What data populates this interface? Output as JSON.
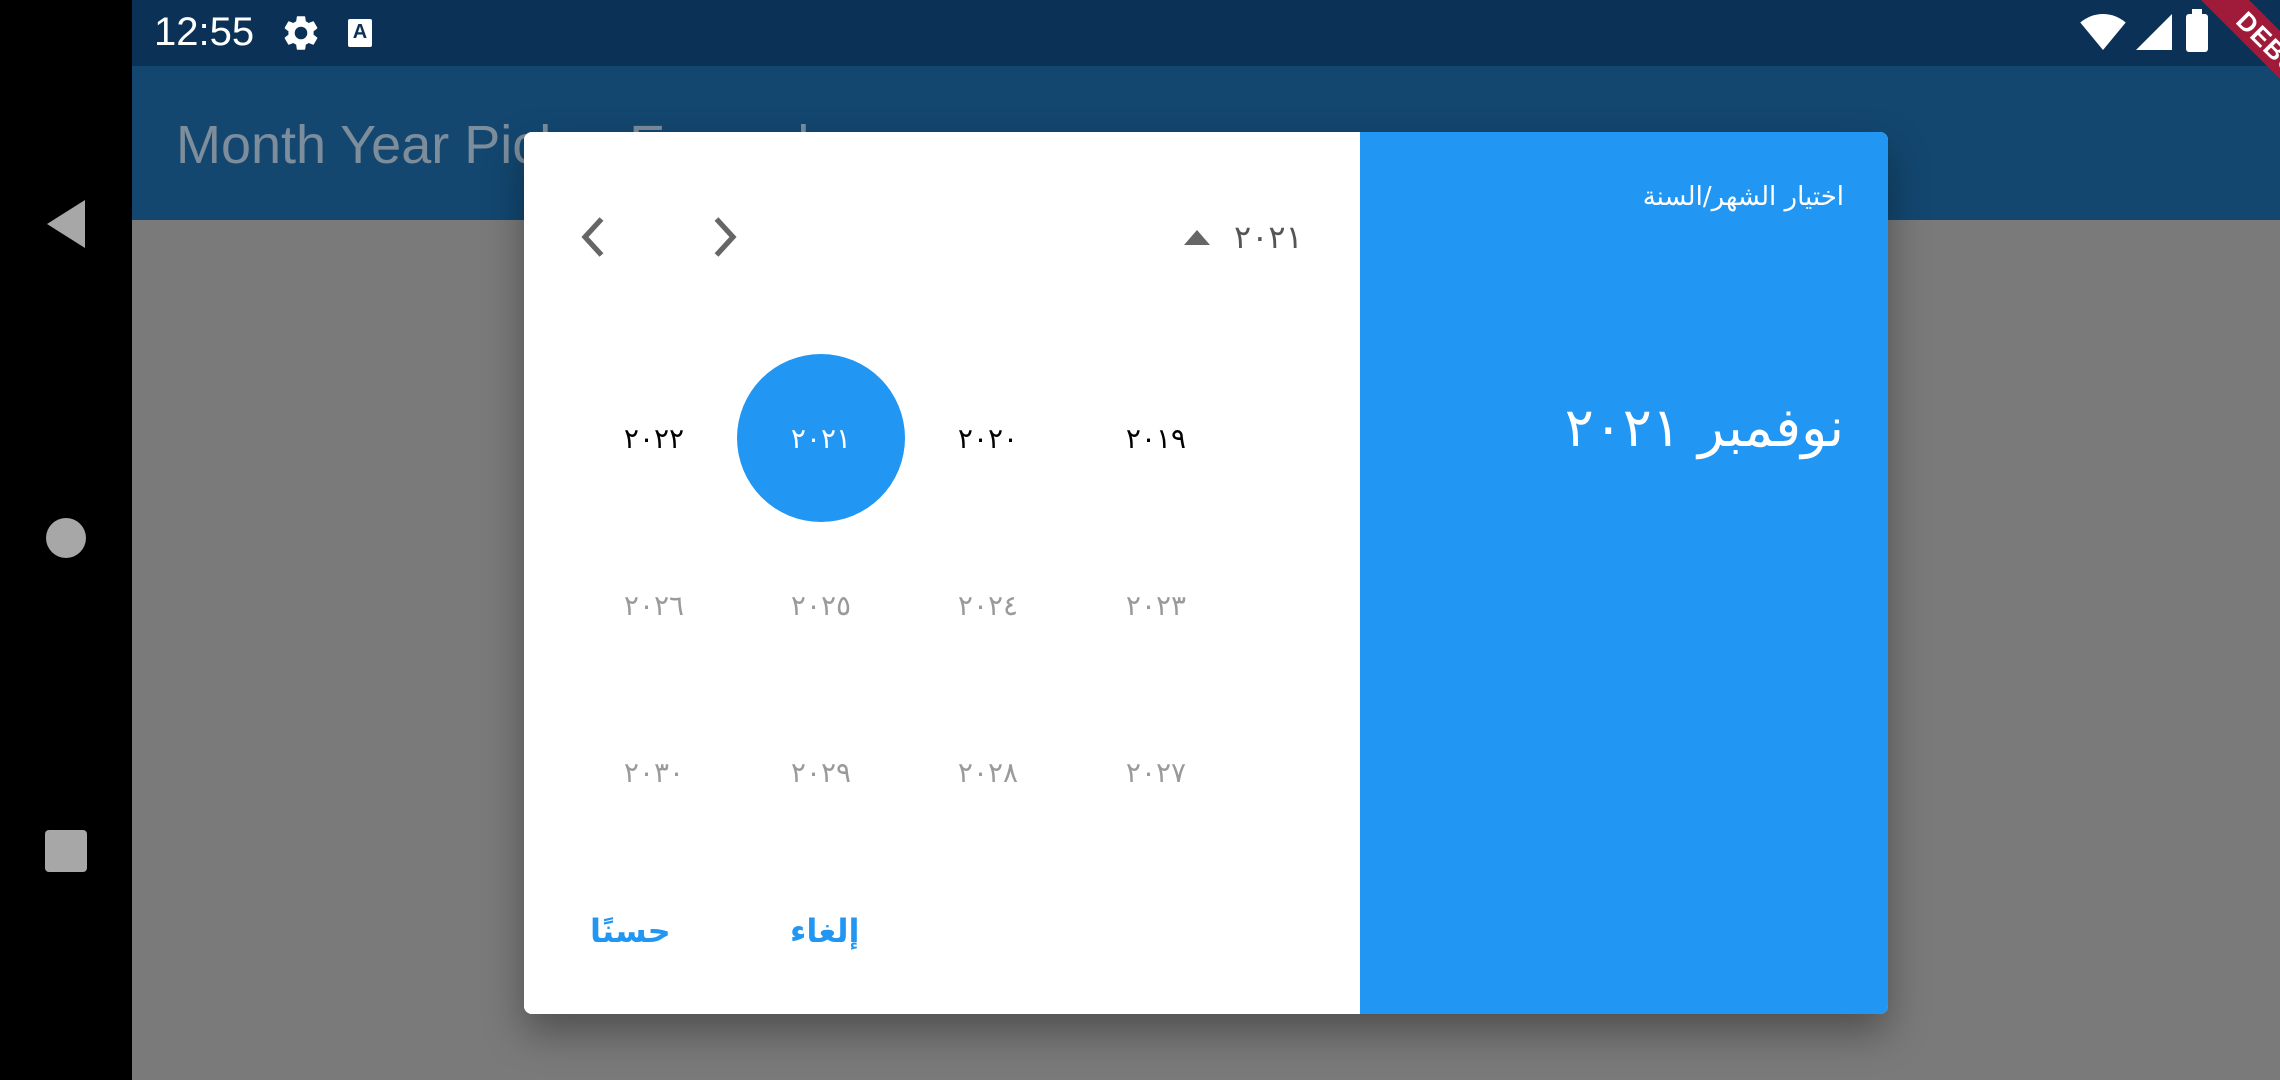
{
  "status_bar": {
    "time": "12:55",
    "icons": [
      "gear-icon",
      "a-keyboard-icon",
      "wifi-icon",
      "signal-icon",
      "battery-icon"
    ]
  },
  "debug_banner": "DEBUG",
  "app_bar": {
    "title": "Month Year Picker Example"
  },
  "dialog": {
    "header": {
      "caption": "اختيار الشهر/السنة",
      "selected": "نوفمبر ٢٠٢١"
    },
    "toolbar": {
      "current_year": "٢٠٢١",
      "prev_icon": "chevron-left-icon",
      "next_icon": "chevron-right-icon",
      "toggle_icon": "caret-up-icon"
    },
    "years": {
      "y2019": "٢٠١٩",
      "y2020": "٢٠٢٠",
      "y2021": "٢٠٢١",
      "y2022": "٢٠٢٢",
      "y2023": "٢٠٢٣",
      "y2024": "٢٠٢٤",
      "y2025": "٢٠٢٥",
      "y2026": "٢٠٢٦",
      "y2027": "٢٠٢٧",
      "y2028": "٢٠٢٨",
      "y2029": "٢٠٢٩",
      "y2030": "٢٠٣٠"
    },
    "selected_year": "y2021",
    "actions": {
      "ok": "حسنًا",
      "cancel": "إلغاء"
    }
  },
  "colors": {
    "status_bar": "#0c3156",
    "app_bar": "#134770",
    "scrim_background": "#7a7a7a",
    "accent": "#2196f3",
    "debug_banner": "#a01b39"
  },
  "system_nav": [
    "back-icon",
    "home-icon",
    "recents-icon"
  ]
}
